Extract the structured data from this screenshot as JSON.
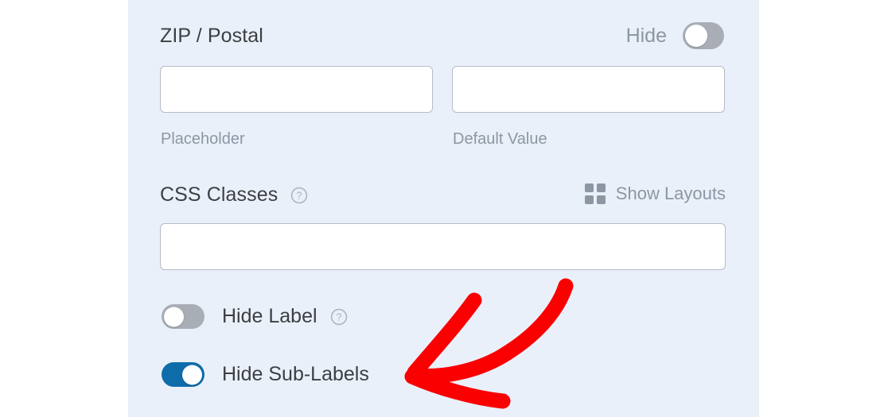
{
  "panel": {
    "background_color": "#eaf0fa",
    "fields": {
      "zip_postal": {
        "label": "ZIP / Postal",
        "placeholder_input": {
          "value": "",
          "placeholder": ""
        },
        "placeholder_sublabel": "Placeholder",
        "default_input": {
          "value": "",
          "placeholder": ""
        },
        "default_sublabel": "Default Value"
      },
      "hide": {
        "label": "Hide",
        "toggle_state": "off"
      },
      "css_classes": {
        "label": "CSS Classes",
        "help_icon": "question-mark-icon",
        "input": {
          "value": "",
          "placeholder": ""
        }
      },
      "show_layouts": {
        "label": "Show Layouts",
        "icon": "grid-layout-icon"
      },
      "hide_label": {
        "label": "Hide Label",
        "toggle_state": "off",
        "help_icon": "question-mark-icon"
      },
      "hide_sub_labels": {
        "label": "Hide Sub-Labels",
        "toggle_state": "on"
      }
    }
  },
  "colors": {
    "panel_bg": "#eaf0fa",
    "label_text": "#3c3f42",
    "muted_text": "#8d96a3",
    "toggle_on": "#0f6cab",
    "toggle_off": "#a9aeb6",
    "input_border": "#b5bcc6",
    "annotation_red": "#fa0000"
  },
  "annotation": {
    "type": "hand-drawn-arrow",
    "color": "#fa0000",
    "points_to": "Hide Sub-Labels"
  }
}
